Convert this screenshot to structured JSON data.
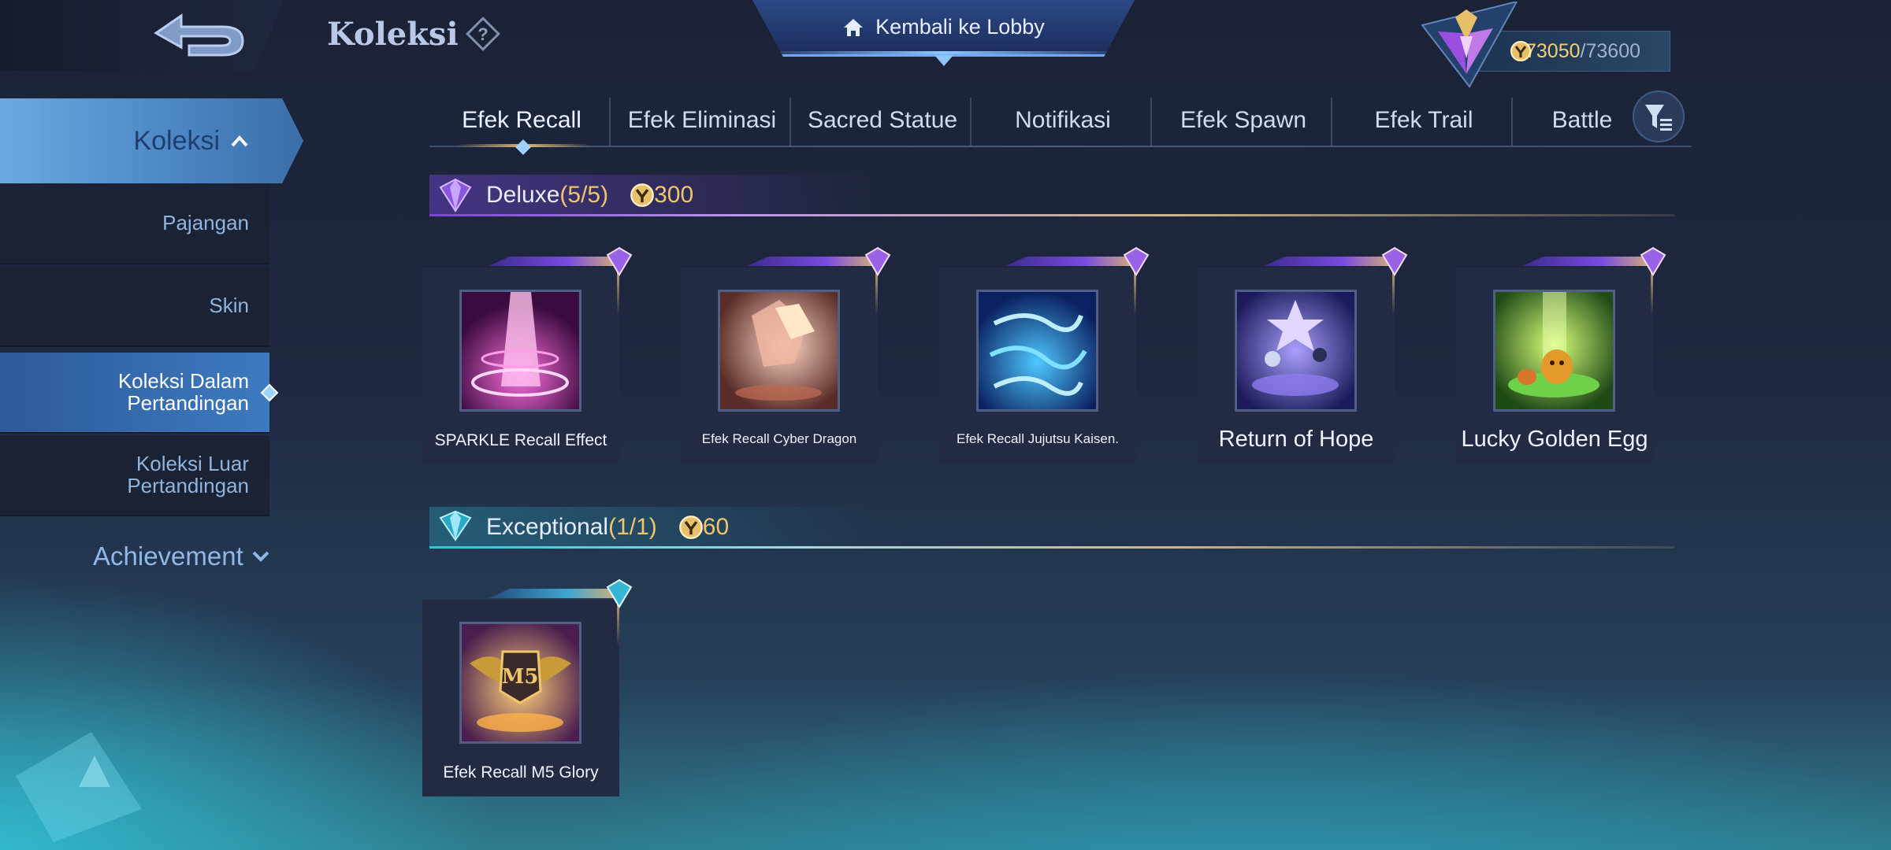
{
  "header": {
    "title": "Koleksi",
    "lobby_label": "Kembali ke Lobby",
    "points_current": "73050",
    "points_sep": "/",
    "points_max": "73600"
  },
  "sidebar": {
    "main_label": "Koleksi",
    "items": [
      {
        "label": "Pajangan"
      },
      {
        "label": "Skin"
      },
      {
        "label": "Koleksi Dalam\nPertandingan",
        "line1": "Koleksi Dalam",
        "line2": "Pertandingan"
      },
      {
        "line1": "Koleksi Luar",
        "line2": "Pertandingan"
      }
    ],
    "achievement_label": "Achievement"
  },
  "tabs": [
    {
      "label": "Efek Recall",
      "active": true
    },
    {
      "label": "Efek Eliminasi"
    },
    {
      "label": "Sacred Statue"
    },
    {
      "label": "Notifikasi"
    },
    {
      "label": "Efek Spawn"
    },
    {
      "label": "Efek Trail"
    },
    {
      "label": "Battle"
    }
  ],
  "sections": {
    "deluxe": {
      "title": "Deluxe",
      "count": "(5/5)",
      "cost": "300",
      "items": [
        {
          "label": "SPARKLE Recall Effect"
        },
        {
          "label": "Efek Recall Cyber Dragon"
        },
        {
          "label": "Efek Recall Jujutsu Kaisen."
        },
        {
          "label": "Return of Hope"
        },
        {
          "label": "Lucky Golden Egg"
        }
      ]
    },
    "exceptional": {
      "title": "Exceptional",
      "count": "(1/1)",
      "cost": "60",
      "items": [
        {
          "label": "Efek Recall M5 Glory",
          "badge_text": "M5"
        }
      ]
    }
  },
  "colors": {
    "accent_gold": "#f0c66c",
    "active_blue": "#3d7ac0",
    "deluxe_purple": "#7a44d6",
    "exceptional_cyan": "#2fc3d8"
  },
  "icons": [
    "back-arrow-icon",
    "help-icon",
    "home-icon",
    "rank-emblem-icon",
    "coin-icon",
    "chevron-up-icon",
    "chevron-down-icon",
    "filter-icon",
    "deluxe-gem-icon",
    "exceptional-gem-icon"
  ]
}
